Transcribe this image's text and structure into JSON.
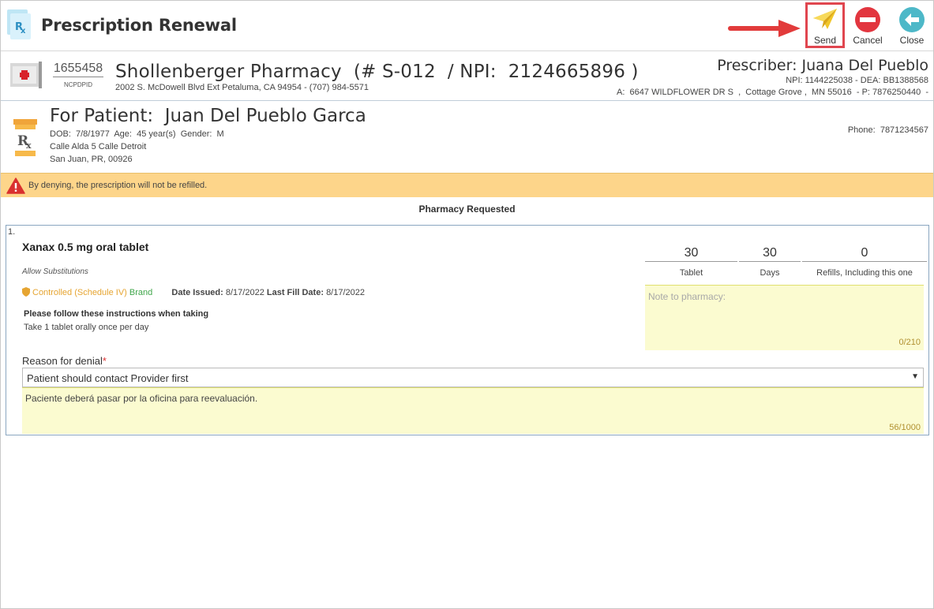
{
  "header": {
    "title": "Prescription Renewal",
    "send_label": "Send",
    "cancel_label": "Cancel",
    "close_label": "Close"
  },
  "pharmacy": {
    "ncpdpid": "1655458",
    "ncpdpid_label": "NCPDPID",
    "name": "Shollenberger Pharmacy  (# S-012  / NPI:  2124665896 )",
    "address": "2002 S. McDowell Blvd Ext Petaluma, CA 94954 - (707) 984-5571"
  },
  "prescriber": {
    "name": "Prescriber: Juana Del Pueblo",
    "ids": "NPI: 1144225038 - DEA: BB1388568",
    "address": "A:  6647 WILDFLOWER DR S  ,  Cottage Grove ,  MN 55016  - P: 7876250440  -"
  },
  "patient": {
    "name": "For Patient:  Juan Del Pueblo Garca",
    "demographics": "DOB:  7/8/1977  Age:  45 year(s)  Gender:  M",
    "address1": "Calle Alda 5 Calle Detroit",
    "address2": "San Juan, PR, 00926",
    "phone": "Phone:  7871234567"
  },
  "warning": {
    "text": "By denying, the prescription will not be refilled."
  },
  "section_title": "Pharmacy Requested",
  "medication": {
    "index": "1.",
    "name": "Xanax 0.5 mg oral tablet",
    "substitutions": "Allow Substitutions",
    "controlled": "Controlled (Schedule IV)",
    "brand": "Brand",
    "date_issued_label": "Date Issued:",
    "date_issued": "8/17/2022",
    "last_fill_label": "Last Fill Date:",
    "last_fill": "8/17/2022",
    "instructions_heading": "Please follow these instructions when taking",
    "instructions": "Take 1 tablet orally once per day",
    "quantity": "30",
    "quantity_unit": "Tablet",
    "days": "30",
    "days_unit": "Days",
    "refills": "0",
    "refills_unit": "Refills, Including this one",
    "note_placeholder": "Note to pharmacy:",
    "note_count": "0/210"
  },
  "denial": {
    "label": "Reason for denial",
    "required_mark": "*",
    "selected": "Patient should contact Provider first",
    "comment": "Paciente deberá pasar por la oficina para reevaluación.",
    "comment_count": "56/1000"
  },
  "colors": {
    "warning_bg": "#fdd58a",
    "note_bg": "#fbfbd0",
    "send_highlight": "#e0464f",
    "cancel_red": "#e2363f",
    "close_teal": "#4db8c8"
  }
}
